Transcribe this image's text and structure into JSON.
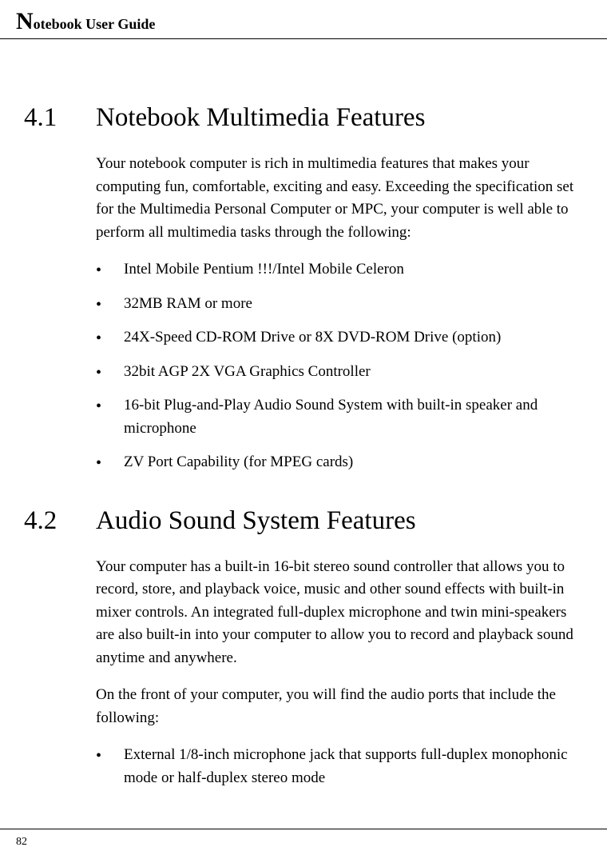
{
  "header": {
    "dropcap": "N",
    "title": "otebook User Guide"
  },
  "sections": [
    {
      "number": "4.1",
      "title": "Notebook Multimedia Features",
      "paragraphs": [
        "Your notebook computer is rich in multimedia features that makes your computing fun, comfortable, exciting and easy. Exceeding the specification set for the Multimedia Personal Computer or MPC, your computer is well able to perform all multimedia tasks through the following:"
      ],
      "bullets": [
        "Intel Mobile Pentium !!!/Intel Mobile Celeron",
        "32MB RAM or more",
        "24X-Speed CD-ROM Drive or 8X DVD-ROM Drive (option)",
        "32bit AGP 2X VGA Graphics Controller",
        "16-bit Plug-and-Play Audio Sound System with built-in speaker and microphone",
        "ZV Port Capability (for MPEG cards)"
      ]
    },
    {
      "number": "4.2",
      "title": "Audio Sound System Features",
      "paragraphs": [
        "Your computer has a built-in 16-bit stereo sound controller that allows you to record, store, and playback voice, music and other sound effects with built-in mixer controls. An integrated full-duplex microphone and twin mini-speakers are also built-in into your computer to allow you to record and playback sound anytime and anywhere.",
        "On the front of your computer, you will find the audio ports that include the following:"
      ],
      "bullets": [
        "External 1/8-inch microphone jack that supports full-duplex monophonic mode or half-duplex stereo mode"
      ]
    }
  ],
  "footer": {
    "page_number": "82"
  }
}
